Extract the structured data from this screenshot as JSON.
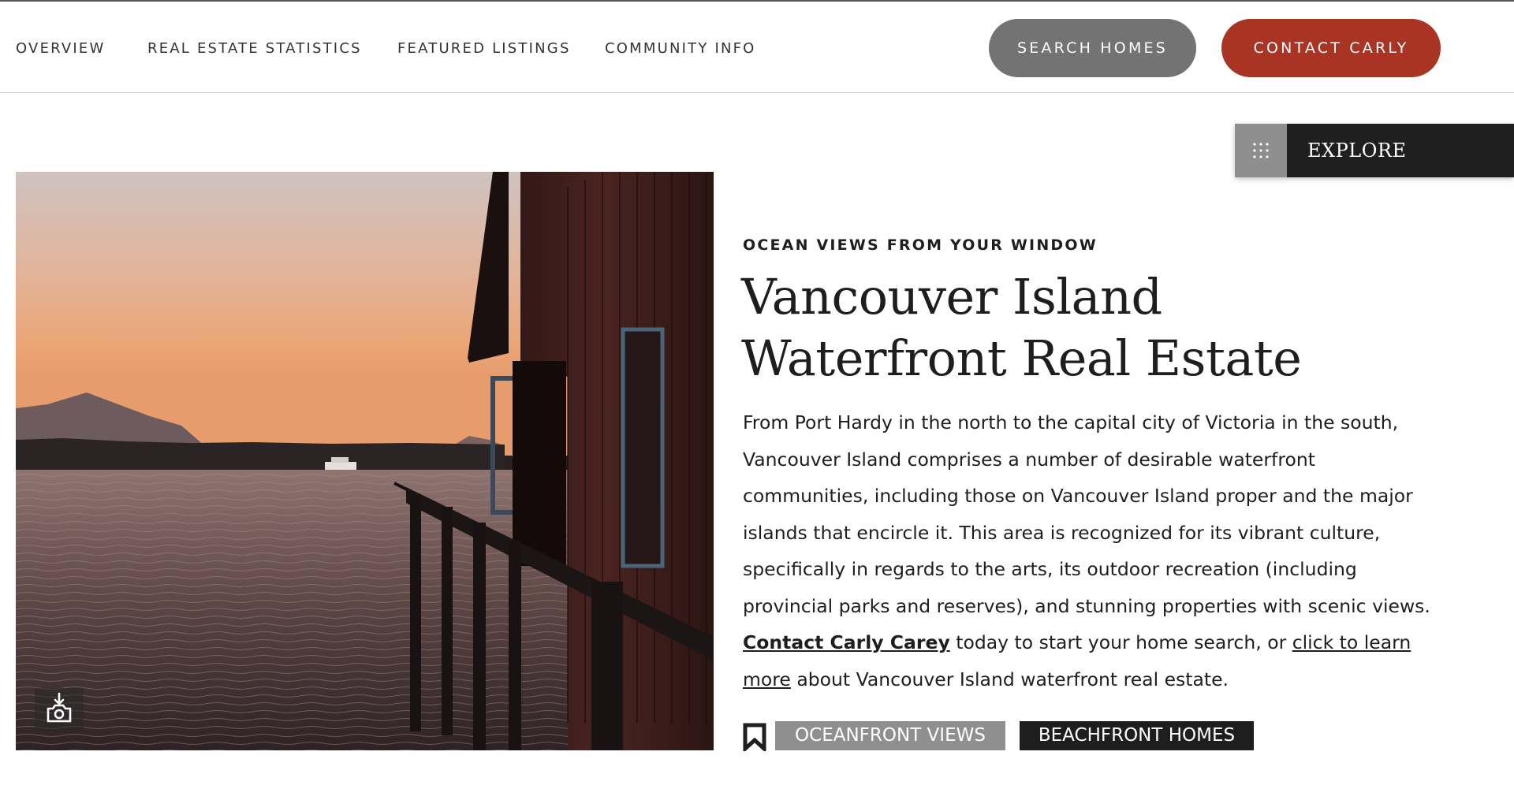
{
  "nav": {
    "links": [
      {
        "label": "OVERVIEW"
      },
      {
        "label": "REAL ESTATE STATISTICS"
      },
      {
        "label": "FEATURED LISTINGS"
      },
      {
        "label": "COMMUNITY INFO"
      }
    ],
    "search_button": "SEARCH HOMES",
    "contact_button": "CONTACT CARLY"
  },
  "explore": {
    "label": "EXPLORE",
    "icon": "grid-dots-icon"
  },
  "hero": {
    "photo_icon": "camera-download-icon",
    "eyebrow": "OCEAN VIEWS FROM YOUR WINDOW",
    "headline_line1": "Vancouver Island",
    "headline_line2": "Waterfront Real Estate",
    "body_part1": "From Port Hardy in the north to the capital city of Victoria in the south, Vancouver Island comprises a number of desirable waterfront communities, including those on Vancouver Island proper and the major islands that encircle it. This area is recognized for its vibrant culture, specifically in regards to the arts, its outdoor recreation (including provincial parks and reserves), and stunning properties with scenic views. ",
    "contact_link": "Contact Carly Carey",
    "body_part2": " today to start your home search, or ",
    "learn_link": "click to learn more",
    "body_part3": " about Vancouver Island waterfront real estate.",
    "bookmark_icon": "bookmark-icon",
    "tags": [
      {
        "label": "OCEANFRONT VIEWS"
      },
      {
        "label": "BEACHFRONT HOMES"
      }
    ]
  },
  "colors": {
    "accent_red": "#a93423",
    "search_gray": "#737373",
    "explore_dark": "#1f1f1f",
    "tag_gray": "#8f8f8f",
    "tag_dark": "#1e1e1e"
  }
}
